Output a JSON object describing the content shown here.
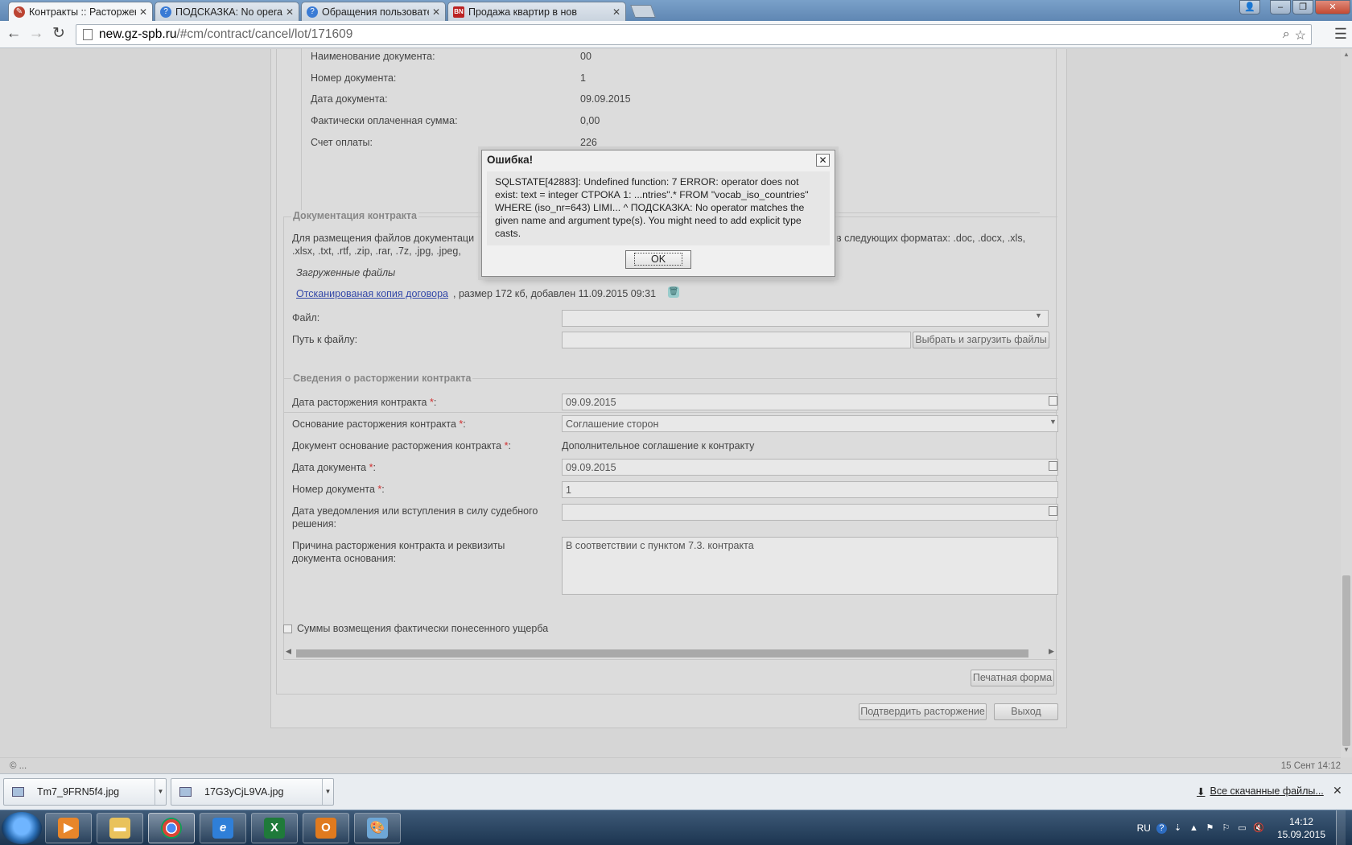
{
  "browser": {
    "tabs": [
      {
        "title": "Контракты :: Расторжени",
        "active": true,
        "icon": "wrench-icon"
      },
      {
        "title": "ПОДСКАЗКА: No operato",
        "active": false,
        "icon": "help-icon"
      },
      {
        "title": "Обращения пользовател",
        "active": false,
        "icon": "help-icon"
      },
      {
        "title": "Продажа квартир в нов",
        "active": false,
        "icon": "bn-logo-icon",
        "icon_text": "BN"
      }
    ],
    "address": {
      "host": "new.gz-spb.ru",
      "path": "/#cm/contract/cancel/lot/171609"
    }
  },
  "payment_section": {
    "rows": [
      {
        "label": "Наименование документа:",
        "value": "00"
      },
      {
        "label": "Номер документа:",
        "value": "1"
      },
      {
        "label": "Дата документа:",
        "value": "09.09.2015"
      },
      {
        "label": "Фактически оплаченная сумма:",
        "value": "0,00"
      },
      {
        "label": "Счет оплаты:",
        "value": "226"
      }
    ]
  },
  "docs_section": {
    "legend": "Документация контракта",
    "note_line1_left": "Для размещения файлов документаци",
    "note_line1_right": "в следующих форматах: .doc, .docx, .xls,",
    "note_line2": ".xlsx, .txt, .rtf, .zip, .rar, .7z, .jpg, .jpeg,",
    "uploaded_heading": "Загруженные файлы",
    "file_link": "Отсканированая копия договора",
    "file_meta": ", размер 172 кб, добавлен 11.09.2015 09:31",
    "file_label": "Файл:",
    "path_label": "Путь к файлу:",
    "upload_button": "Выбрать и загрузить файлы"
  },
  "termination_section": {
    "legend": "Сведения о расторжении контракта",
    "date_label": "Дата расторжения контракта",
    "date_value": "09.09.2015",
    "basis_label": "Основание расторжения контракта",
    "basis_value": "Соглашение сторон",
    "basis_doc_label": "Документ основание расторжения контракта",
    "basis_doc_value": "Дополнительное соглашение к контракту",
    "doc_date_label": "Дата документа",
    "doc_date_value": "09.09.2015",
    "doc_number_label": "Номер документа",
    "doc_number_value": "1",
    "notify_label_line1": "Дата уведомления или вступления в силу судебного",
    "notify_label_line2": "решения:",
    "notify_value": "",
    "reason_label_line1": "Причина расторжения контракта и реквизиты",
    "reason_label_line2": "документа основания:",
    "reason_value": "В соответствии с пунктом 7.3. контракта",
    "required_mark": "*",
    "colon": ":"
  },
  "damages_checkbox_label": "Суммы возмещения фактически понесенного ущерба",
  "buttons": {
    "print": "Печатная форма",
    "confirm": "Подтвердить расторжение",
    "exit": "Выход"
  },
  "status": {
    "left": "© ...",
    "right": "15 Сент 14:12"
  },
  "modal": {
    "title": "Ошибка!",
    "message": "SQLSTATE[42883]: Undefined function: 7 ERROR: operator does not exist: text = integer СТРОКА 1: ...ntries\".* FROM \"vocab_iso_countries\" WHERE (iso_nr=643) LIMI... ^ ПОДСКАЗКА: No operator matches the given name and argument type(s). You might need to add explicit type casts.",
    "ok": "OK"
  },
  "downloads": {
    "items": [
      "Tm7_9FRN5f4.jpg",
      "17G3yCjL9VA.jpg"
    ],
    "all_link": "Все скачанные файлы..."
  },
  "taskbar": {
    "lang": "RU",
    "time": "14:12",
    "date": "15.09.2015",
    "apps": [
      {
        "name": "media-player-icon",
        "color": "#e8862a"
      },
      {
        "name": "file-explorer-icon",
        "color": "#e9c25c"
      },
      {
        "name": "chrome-icon",
        "color": "#d84a3a"
      },
      {
        "name": "internet-explorer-icon",
        "color": "#2f7fd8",
        "text": "e"
      },
      {
        "name": "excel-icon",
        "color": "#1f7a3a",
        "text": "X"
      },
      {
        "name": "outlook-icon",
        "color": "#e07a1e",
        "text": "O"
      },
      {
        "name": "paint-icon",
        "color": "#6ea7d6"
      }
    ]
  }
}
